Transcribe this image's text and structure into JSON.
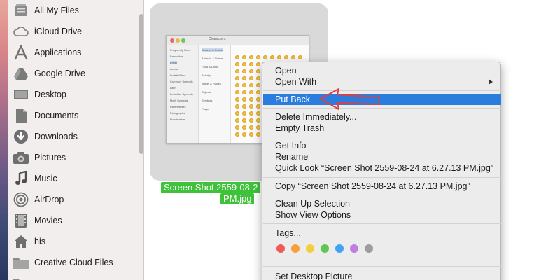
{
  "sidebar": {
    "items": [
      {
        "label": "All My Files",
        "icon": "all-files-icon"
      },
      {
        "label": "iCloud Drive",
        "icon": "cloud-icon"
      },
      {
        "label": "Applications",
        "icon": "applications-icon"
      },
      {
        "label": "Google Drive",
        "icon": "google-drive-icon"
      },
      {
        "label": "Desktop",
        "icon": "desktop-icon"
      },
      {
        "label": "Documents",
        "icon": "documents-icon"
      },
      {
        "label": "Downloads",
        "icon": "downloads-icon"
      },
      {
        "label": "Pictures",
        "icon": "camera-icon"
      },
      {
        "label": "Music",
        "icon": "music-note-icon"
      },
      {
        "label": "AirDrop",
        "icon": "airdrop-icon"
      },
      {
        "label": "Movies",
        "icon": "film-icon"
      },
      {
        "label": "his",
        "icon": "home-icon"
      },
      {
        "label": "Creative Cloud Files",
        "icon": "folder-icon"
      }
    ]
  },
  "file": {
    "caption_line1": "Screen Shot 2559-08-2",
    "caption_line2": "PM.jpg",
    "thumbnail": {
      "window_title": "Characters",
      "sidebar_rows": [
        "Frequently Used",
        "Favourites",
        "Emoji",
        "Arrows",
        "Bullets/Stars",
        "Currency Symbols",
        "Latin",
        "Letterlike Symbols",
        "Math Symbols",
        "Parentheses",
        "Pictographs",
        "Punctuation"
      ],
      "category_rows": [
        "Smileys & People",
        "Animals & Nature",
        "Food & Drink",
        "Activity",
        "Travel & Places",
        "Objects",
        "Symbols",
        "Flags"
      ]
    }
  },
  "context_menu": {
    "open": "Open",
    "open_with": "Open With",
    "put_back": "Put Back",
    "delete_immediately": "Delete Immediately...",
    "empty_trash": "Empty Trash",
    "get_info": "Get Info",
    "rename": "Rename",
    "quick_look": "Quick Look “Screen Shot 2559-08-24 at 6.27.13 PM.jpg”",
    "copy": "Copy “Screen Shot 2559-08-24 at 6.27.13 PM.jpg”",
    "clean_up_selection": "Clean Up Selection",
    "show_view_options": "Show View Options",
    "tags": "Tags...",
    "tag_colors": [
      "#f05a55",
      "#f5a03a",
      "#f4cf3a",
      "#5cc853",
      "#3fa5f2",
      "#c07ee0",
      "#9d9d9d"
    ],
    "set_desktop_picture": "Set Desktop Picture",
    "highlighted_item": "Put Back"
  },
  "colors": {
    "selection_blue": "#2a7ddf",
    "filename_highlight": "#3ec23a",
    "annotation_arrow": "#e53b3b"
  }
}
